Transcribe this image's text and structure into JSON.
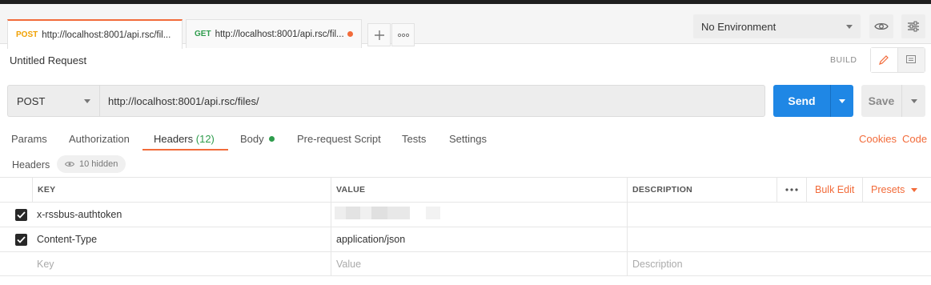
{
  "tabs": [
    {
      "method": "POST",
      "url": "http://localhost:8001/api.rsc/fil...",
      "unsaved": true
    },
    {
      "method": "GET",
      "url": "http://localhost:8001/api.rsc/fil...",
      "unsaved": true
    }
  ],
  "environment": {
    "selected": "No Environment"
  },
  "request": {
    "title": "Untitled Request",
    "mode_label": "BUILD",
    "method": "POST",
    "url": "http://localhost:8001/api.rsc/files/",
    "send_label": "Send",
    "save_label": "Save"
  },
  "subtabs": {
    "params": "Params",
    "authorization": "Authorization",
    "headers": "Headers",
    "headers_count": "(12)",
    "body": "Body",
    "prerequest": "Pre-request Script",
    "tests": "Tests",
    "settings": "Settings",
    "cookies": "Cookies",
    "code": "Code"
  },
  "headers_section": {
    "label": "Headers",
    "hidden_text": "10 hidden"
  },
  "table": {
    "columns": {
      "key": "KEY",
      "value": "VALUE",
      "description": "DESCRIPTION"
    },
    "bulk_edit": "Bulk Edit",
    "presets": "Presets",
    "rows": [
      {
        "checked": true,
        "key": "x-rssbus-authtoken",
        "value": "",
        "description": ""
      },
      {
        "checked": true,
        "key": "Content-Type",
        "value": "application/json",
        "description": ""
      }
    ],
    "placeholders": {
      "key": "Key",
      "value": "Value",
      "description": "Description"
    }
  },
  "colors": {
    "accent_orange": "#f26b3a",
    "send_blue": "#1f87e5",
    "post_method": "#f0a000",
    "get_method": "#2e9c4c"
  }
}
